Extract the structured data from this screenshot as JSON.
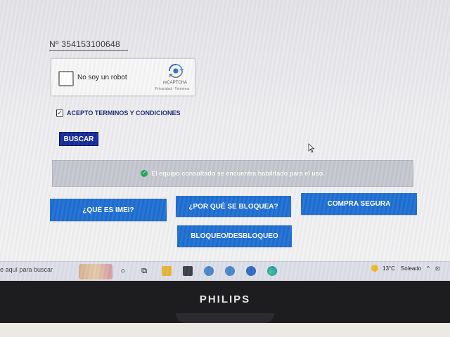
{
  "form": {
    "imei_prefix": "Nº",
    "imei_value": "354153100648",
    "captcha": {
      "label": "No soy un robot",
      "brand": "reCAPTCHA",
      "links": "Privacidad - Términos"
    },
    "terms_label": "ACEPTO TERMINOS Y CONDICIONES",
    "search_button": "BUSCAR"
  },
  "status": {
    "message": "El equipo consultado se encuentra habilitado para el uso.",
    "color": "#21a35a"
  },
  "buttons": {
    "que_es_imei": "¿QUÉ ES IMEI?",
    "por_que_bloquea": "¿POR QUÉ SE BLOQUEA?",
    "compra_segura": "COMPRA SEGURA",
    "bloqueo": "BLOQUEO/DESBLOQUEO"
  },
  "taskbar": {
    "search_placeholder": "e aquí para buscar",
    "temperature": "13°C",
    "weather": "Soleado",
    "icons": [
      "search-icon",
      "task-view-icon",
      "file-explorer-icon",
      "calculator-icon",
      "app-icon",
      "app-icon",
      "app-icon",
      "edge-icon"
    ]
  },
  "monitor": {
    "brand": "PHILIPS"
  },
  "colors": {
    "primary_button": "#1e6fd3",
    "search_button": "#152a9a",
    "status_bg": "#c4c7cf"
  }
}
